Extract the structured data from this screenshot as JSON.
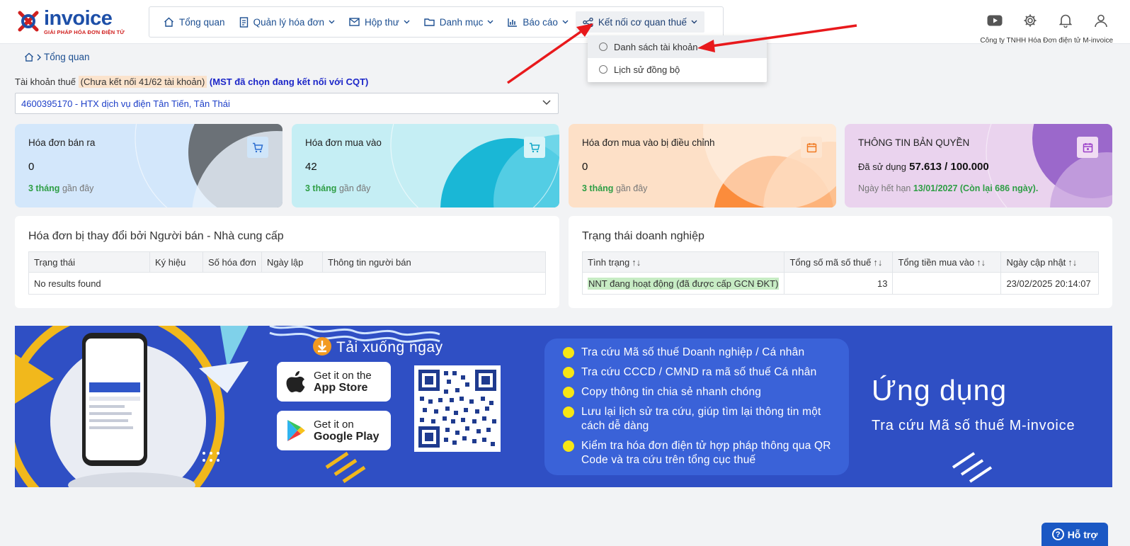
{
  "brand": {
    "name": "invoice",
    "tagline": "GIẢI PHÁP HÓA ĐƠN ĐIỆN TỬ"
  },
  "nav": {
    "items": [
      {
        "label": "Tổng quan",
        "icon": "home-icon"
      },
      {
        "label": "Quản lý hóa đơn",
        "icon": "document-icon"
      },
      {
        "label": "Hộp thư",
        "icon": "mail-icon"
      },
      {
        "label": "Danh mục",
        "icon": "folder-icon"
      },
      {
        "label": "Báo cáo",
        "icon": "bar-chart-icon"
      },
      {
        "label": "Kết nối cơ quan thuế",
        "icon": "share-icon"
      }
    ],
    "dropdown": [
      "Danh sách tài khoản",
      "Lịch sử đồng bộ"
    ]
  },
  "header": {
    "company": "Công ty TNHH Hóa Đơn điện tử M-invoice"
  },
  "breadcrumb": "Tổng quan",
  "tax": {
    "label": "Tài khoản thuế",
    "status": "(Chưa kết nối 41/62 tài khoản)",
    "note": "(MST đã chọn đang kết nối với CQT)",
    "selected": "4600395170 - HTX dịch vụ điện Tân Tiến, Tân Thái"
  },
  "cards": [
    {
      "title": "Hóa đơn bán ra",
      "value": "0",
      "foot_bold": "3 tháng",
      "foot": "gần đây"
    },
    {
      "title": "Hóa đơn mua vào",
      "value": "42",
      "foot_bold": "3 tháng",
      "foot": "gần đây"
    },
    {
      "title": "Hóa đơn mua vào bị điều chỉnh",
      "value": "0",
      "foot_bold": "3 tháng",
      "foot": "gần đây"
    },
    {
      "title": "THÔNG TIN BẢN QUYỀN",
      "value_prefix": "Đã sử dụng",
      "value": "57.613 / 100.000",
      "foot": "Ngày hết hạn",
      "foot_bold": "13/01/2027 (Còn lại 686 ngày)."
    }
  ],
  "seller_panel": {
    "title": "Hóa đơn bị thay đổi bởi Người bán - Nhà cung cấp",
    "columns": [
      "Trạng thái",
      "Ký hiệu",
      "Số hóa đơn",
      "Ngày lập",
      "Thông tin người bán"
    ],
    "empty": "No results found"
  },
  "status_panel": {
    "title": "Trạng thái doanh nghiệp",
    "columns": [
      "Tình trạng",
      "Tổng số mã số thuế",
      "Tổng tiền mua vào",
      "Ngày cập nhật"
    ],
    "row": {
      "status": "NNT đang hoạt động (đã được cấp GCN ĐKT)",
      "count": "13",
      "amount": "",
      "updated": "23/02/2025 20:14:07"
    }
  },
  "banner": {
    "download": "Tải xuống ngay",
    "appstore": {
      "l1": "Get it on the",
      "l2": "App Store"
    },
    "googleplay": {
      "l1": "Get it on",
      "l2": "Google Play"
    },
    "features": [
      "Tra cứu Mã số thuế Doanh nghiệp / Cá nhân",
      "Tra cứu CCCD / CMND ra mã số thuế Cá nhân",
      "Copy thông tin chia sẻ nhanh chóng",
      "Lưu lại lịch sử tra cứu, giúp tìm lại thông tin một cách dễ dàng",
      "Kiểm tra hóa đơn điện tử hợp pháp thông qua QR Code và tra cứu trên tổng cục thuế"
    ],
    "headline": "Ứng dụng",
    "subheadline": "Tra cứu Mã số thuế M-invoice"
  },
  "support": "Hỗ trợ",
  "colors": {
    "brand_blue": "#1d4fa8",
    "banner": "#2f4fc4",
    "accent_green": "#2e9e45",
    "arrow": "#e8191c"
  }
}
